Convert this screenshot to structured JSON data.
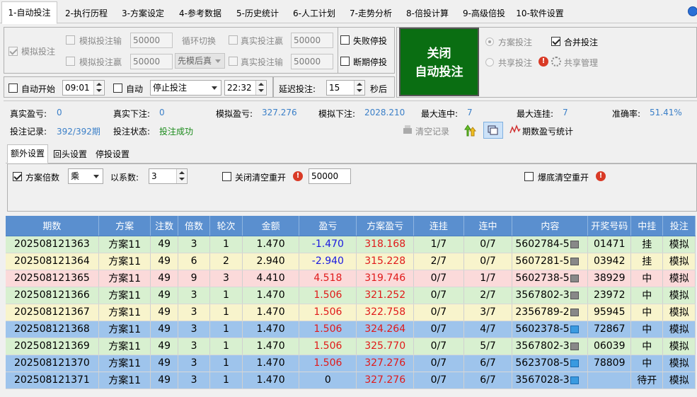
{
  "tabs": [
    "1-自动投注",
    "2-执行历程",
    "3-方案设定",
    "4-参考数据",
    "5-历史统计",
    "6-人工计划",
    "7-走势分析",
    "8-倍投计算",
    "9-高级倍投",
    "10-软件设置"
  ],
  "sim": {
    "label": "模拟投注",
    "loss_label": "模拟投注输",
    "loss_value": "50000",
    "win_label": "模拟投注赢",
    "win_value": "50000",
    "cycle_label": "循环切换",
    "mode_value": "先模后真",
    "real_win_label": "真实投注赢",
    "real_win_value": "50000",
    "real_loss_label": "真实投注输",
    "real_loss_value": "50000"
  },
  "stops": {
    "fail_stop": "失败停投",
    "break_stop": "断期停投"
  },
  "big_button": {
    "line1": "关闭",
    "line2": "自动投注"
  },
  "plan": {
    "plan_bet": "方案投注",
    "merge_bet": "合并投注",
    "share_bet": "共享投注",
    "share_manage": "共享管理"
  },
  "schedule": {
    "auto_start": "自动开始",
    "start_time": "09:01",
    "auto": "自动",
    "action_value": "停止投注",
    "end_time": "22:32",
    "delay_label": "延迟投注:",
    "delay_value": "15",
    "delay_unit": "秒后"
  },
  "stats": {
    "real_pl_label": "真实盈亏:",
    "real_pl": "0",
    "real_bet_label": "真实下注:",
    "real_bet": "0",
    "sim_pl_label": "模拟盈亏:",
    "sim_pl": "327.276",
    "sim_bet_label": "模拟下注:",
    "sim_bet": "2028.210",
    "max_hit_label": "最大连中:",
    "max_hit": "7",
    "max_miss_label": "最大连挂:",
    "max_miss": "7",
    "accuracy_label": "准确率:",
    "accuracy": "51.41%",
    "record_label": "投注记录:",
    "record": "392/392期",
    "status_label": "投注状态:",
    "status": "投注成功",
    "clear_label": "清空记录",
    "period_stats_label": "期数盈亏统计"
  },
  "subtabs": [
    "额外设置",
    "回头设置",
    "停投设置"
  ],
  "extra": {
    "multiplier_label": "方案倍数",
    "op_value": "乘",
    "coef_label": "以系数:",
    "coef_value": "3",
    "close_reset_label": "关闭清空重开",
    "close_reset_value": "50000",
    "burst_reset_label": "爆底清空重开"
  },
  "table": {
    "headers": [
      "期数",
      "方案",
      "注数",
      "倍数",
      "轮次",
      "金额",
      "盈亏",
      "方案盈亏",
      "连挂",
      "连中",
      "内容",
      "开奖号码",
      "中挂",
      "投注"
    ],
    "rows": [
      {
        "c": [
          "202508121363",
          "方案11",
          "49",
          "3",
          "1",
          "1.470",
          "-1.470",
          "318.168",
          "1/7",
          "0/7",
          "5602784-5",
          "01471",
          "挂",
          "模拟"
        ],
        "bg": "#d8f0d0",
        "pl": "neg",
        "memo": "g"
      },
      {
        "c": [
          "202508121364",
          "方案11",
          "49",
          "6",
          "2",
          "2.940",
          "-2.940",
          "315.228",
          "2/7",
          "0/7",
          "5607281-5",
          "03942",
          "挂",
          "模拟"
        ],
        "bg": "#f8f4cc",
        "pl": "neg",
        "memo": "g"
      },
      {
        "c": [
          "202508121365",
          "方案11",
          "49",
          "9",
          "3",
          "4.410",
          "4.518",
          "319.746",
          "0/7",
          "1/7",
          "5602738-5",
          "38929",
          "中",
          "模拟"
        ],
        "bg": "#fbdada",
        "pl": "pos",
        "memo": "g"
      },
      {
        "c": [
          "202508121366",
          "方案11",
          "49",
          "3",
          "1",
          "1.470",
          "1.506",
          "321.252",
          "0/7",
          "2/7",
          "3567802-3",
          "23972",
          "中",
          "模拟"
        ],
        "bg": "#d8f0d0",
        "pl": "pos",
        "memo": "g"
      },
      {
        "c": [
          "202508121367",
          "方案11",
          "49",
          "3",
          "1",
          "1.470",
          "1.506",
          "322.758",
          "0/7",
          "3/7",
          "2356789-2",
          "95945",
          "中",
          "模拟"
        ],
        "bg": "#f8f4cc",
        "pl": "pos",
        "memo": "g"
      },
      {
        "c": [
          "202508121368",
          "方案11",
          "49",
          "3",
          "1",
          "1.470",
          "1.506",
          "324.264",
          "0/7",
          "4/7",
          "5602378-5",
          "72867",
          "中",
          "模拟"
        ],
        "bg": "#9ec4ec",
        "pl": "pos",
        "memo": "b"
      },
      {
        "c": [
          "202508121369",
          "方案11",
          "49",
          "3",
          "1",
          "1.470",
          "1.506",
          "325.770",
          "0/7",
          "5/7",
          "3567802-3",
          "06039",
          "中",
          "模拟"
        ],
        "bg": "#d8f0d0",
        "pl": "pos",
        "memo": "g"
      },
      {
        "c": [
          "202508121370",
          "方案11",
          "49",
          "3",
          "1",
          "1.470",
          "1.506",
          "327.276",
          "0/7",
          "6/7",
          "5623708-5",
          "78809",
          "中",
          "模拟"
        ],
        "bg": "#9ec4ec",
        "pl": "pos",
        "memo": "b"
      },
      {
        "c": [
          "202508121371",
          "方案11",
          "49",
          "3",
          "1",
          "1.470",
          "0",
          "327.276",
          "0/7",
          "6/7",
          "3567028-3",
          "",
          "待开",
          "模拟"
        ],
        "bg": "#9ec4ec",
        "pl": "zero",
        "memo": "b"
      }
    ]
  }
}
